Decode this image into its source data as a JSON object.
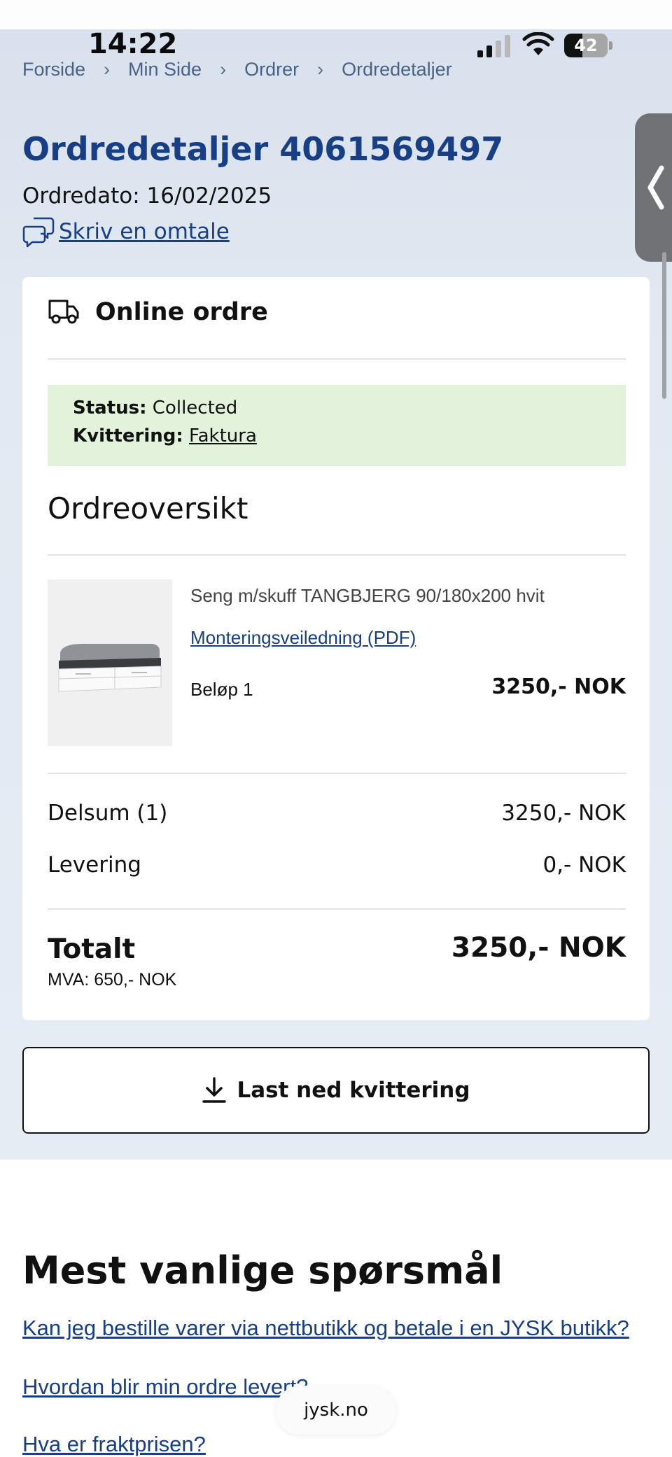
{
  "status_bar": {
    "time": "14:22",
    "battery": "42",
    "battery_level": 0.42
  },
  "breadcrumb": [
    "Forside",
    "Min Side",
    "Ordrer",
    "Ordredetaljer"
  ],
  "header": {
    "title": "Ordredetaljer 4061569497",
    "order_date": "Ordredato: 16/02/2025",
    "review_link": "Skriv en omtale"
  },
  "order": {
    "type_label": "Online ordre",
    "status_label": "Status:",
    "status_value": "Collected",
    "receipt_label": "Kvittering:",
    "receipt_link": "Faktura",
    "overview_title": "Ordreoversikt",
    "item": {
      "name": "Seng m/skuff TANGBJERG 90/180x200 hvit",
      "manual_link": "Monteringsveiledning (PDF)",
      "amount_label": "Beløp 1",
      "price": "3250,- NOK"
    },
    "subtotal_label": "Delsum (1)",
    "subtotal_value": "3250,- NOK",
    "delivery_label": "Levering",
    "delivery_value": "0,- NOK",
    "total_label": "Totalt",
    "total_value": "3250,- NOK",
    "vat": "MVA: 650,- NOK"
  },
  "download_button": "Last ned kvittering",
  "faq": {
    "title": "Mest vanlige spørsmål",
    "questions": [
      "Kan jeg bestille varer via nettbutikk og betale i en JYSK butikk?",
      "Hvordan blir min ordre levert?",
      "Hva er fraktprisen?"
    ]
  },
  "browser": {
    "url": "jysk.no"
  },
  "colors": {
    "accent": "#183f85",
    "status_bg": "#e3f3db",
    "page_bg": "#e2e9f2"
  }
}
